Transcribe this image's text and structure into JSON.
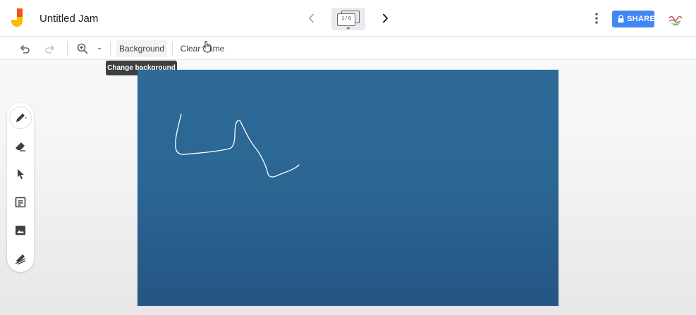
{
  "app": {
    "title": "Untitled Jam",
    "frame_counter": "1 / 6",
    "share_label": "SHARE",
    "accent_color": "#4285f4",
    "logo_icon": "jamboard-logo-icon",
    "avatar_icon": "user-avatar-icon"
  },
  "toolbar": {
    "undo_icon": "undo-icon",
    "redo_icon": "redo-icon",
    "zoom_icon": "zoom-in-icon",
    "zoom_dropdown_icon": "chevron-down-icon",
    "background_label": "Background",
    "clear_label": "Clear frame",
    "tooltip": "Change background"
  },
  "tools": [
    {
      "name": "pen",
      "icon": "pen-icon",
      "active": true
    },
    {
      "name": "eraser",
      "icon": "eraser-icon",
      "active": false
    },
    {
      "name": "select",
      "icon": "select-arrow-icon",
      "active": false
    },
    {
      "name": "sticky-note",
      "icon": "sticky-note-icon",
      "active": false
    },
    {
      "name": "add-image",
      "icon": "image-icon",
      "active": false
    },
    {
      "name": "laser",
      "icon": "laser-icon",
      "active": false
    }
  ],
  "canvas": {
    "background_color": "#2c6794",
    "stroke_color": "#ffffff"
  }
}
